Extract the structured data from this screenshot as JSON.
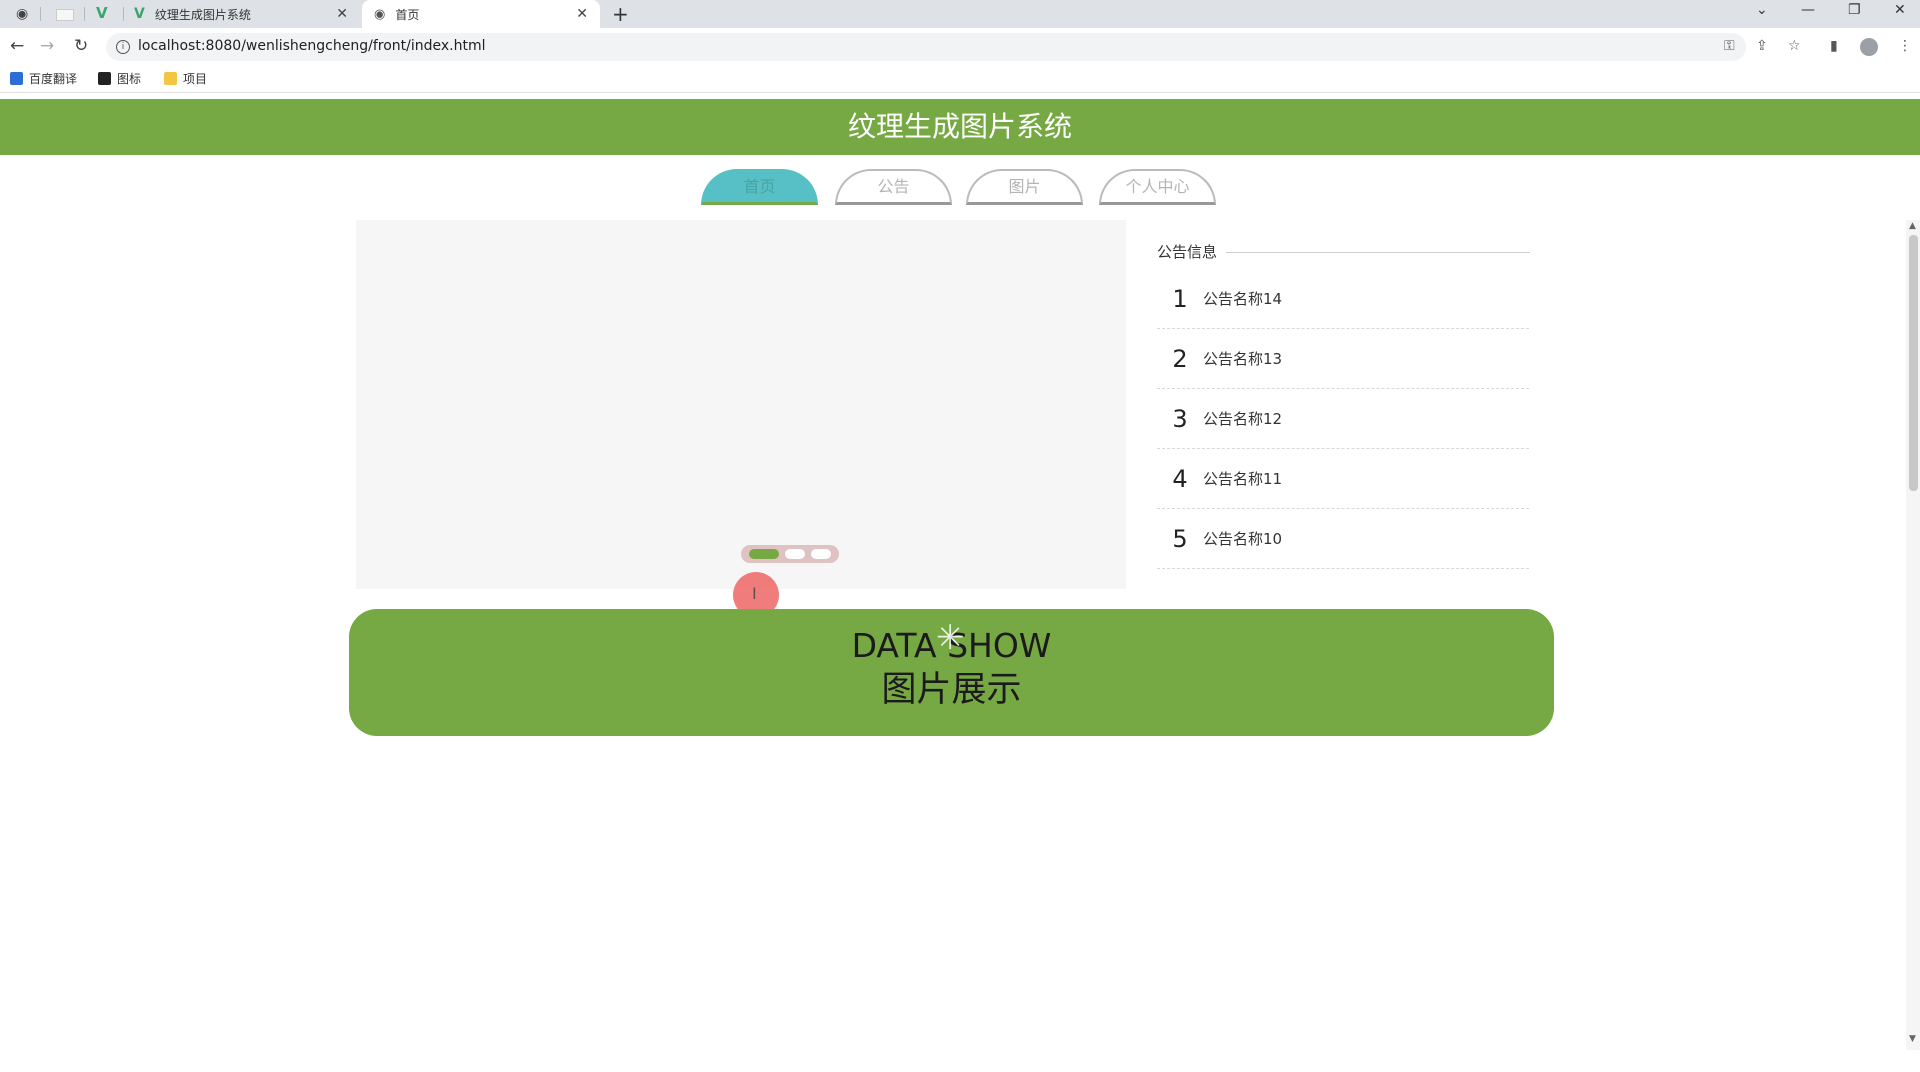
{
  "browser": {
    "tabs": [
      {
        "title": "纹理生成图片系统",
        "active": false
      },
      {
        "title": "首页",
        "active": true
      }
    ],
    "new_tab": "+",
    "url": "localhost:8080/wenlishengcheng/front/index.html",
    "bookmarks": [
      {
        "label": "百度翻译",
        "color": "#2b6fd6"
      },
      {
        "label": "图标",
        "color": "#222222"
      },
      {
        "label": "项目",
        "color": "#f4c542"
      }
    ]
  },
  "page": {
    "title": "纹理生成图片系统",
    "nav": [
      {
        "label": "首页",
        "active": true
      },
      {
        "label": "公告",
        "active": false
      },
      {
        "label": "图片",
        "active": false
      },
      {
        "label": "个人中心",
        "active": false
      }
    ],
    "notice": {
      "title": "公告信息",
      "items": [
        {
          "num": "1",
          "name": "公告名称14"
        },
        {
          "num": "2",
          "name": "公告名称13"
        },
        {
          "num": "3",
          "name": "公告名称12"
        },
        {
          "num": "4",
          "name": "公告名称11"
        },
        {
          "num": "5",
          "name": "公告名称10"
        }
      ]
    },
    "carousel": {
      "slides": 3,
      "active_index": 0
    },
    "datashow": {
      "en": "DATA SHOW",
      "cn": "图片展示"
    }
  },
  "colors": {
    "brand_green": "#76a843",
    "nav_active": "#57c0c7",
    "banner_bg": "#f6f6f6"
  },
  "icons": [
    "globe-icon",
    "vue-icon",
    "close-icon",
    "back-icon",
    "forward-icon",
    "reload-icon",
    "info-icon",
    "key-icon",
    "share-icon",
    "star-icon",
    "sidebar-icon",
    "profile-icon",
    "menu-icon",
    "spinner-icon"
  ]
}
